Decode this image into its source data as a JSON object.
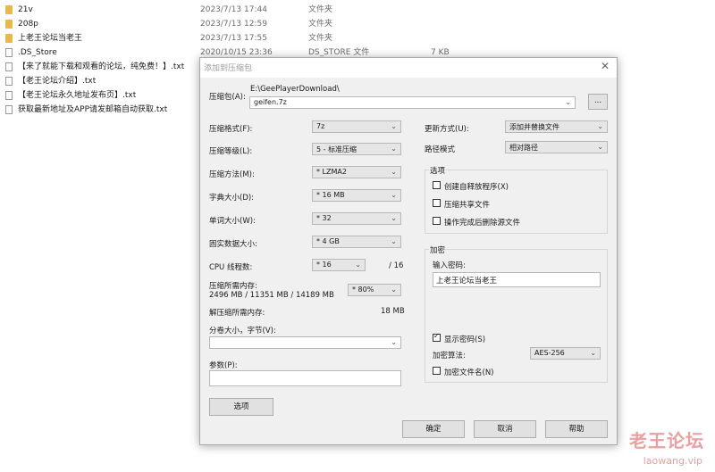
{
  "files": [
    {
      "name": "21v",
      "date": "2023/7/13 17:44",
      "type": "文件夹",
      "size": "",
      "icon": "folder-icon"
    },
    {
      "name": "208p",
      "date": "2023/7/13 12:59",
      "type": "文件夹",
      "size": "",
      "icon": "folder-icon"
    },
    {
      "name": "上老王论坛当老王",
      "date": "2023/7/13 17:55",
      "type": "文件夹",
      "size": "",
      "icon": "folder-icon"
    },
    {
      "name": ".DS_Store",
      "date": "2020/10/15 23:36",
      "type": "DS_STORE 文件",
      "size": "7 KB",
      "icon": "file-icon"
    },
    {
      "name": "【来了就能下载和观看的论坛，纯免费！】.txt",
      "date": "",
      "type": "",
      "size": "",
      "icon": "text-file-icon"
    },
    {
      "name": "【老王论坛介绍】.txt",
      "date": "",
      "type": "",
      "size": "",
      "icon": "text-file-icon"
    },
    {
      "name": "【老王论坛永久地址发布页】.txt",
      "date": "",
      "type": "",
      "size": "",
      "icon": "text-file-icon"
    },
    {
      "name": "获取最新地址及APP请发邮箱自动获取.txt",
      "date": "",
      "type": "",
      "size": "",
      "icon": "text-file-icon"
    }
  ],
  "dialog": {
    "title": "添加到压缩包",
    "archive_label": "压缩包(A):",
    "archive_path": "E:\\GeePlayerDownload\\",
    "archive_name": "geifen.7z",
    "browse_label": "...",
    "format_label": "压缩格式(F):",
    "format_value": "7z",
    "level_label": "压缩等级(L):",
    "level_value": "5 - 标准压缩",
    "method_label": "压缩方法(M):",
    "method_value": "* LZMA2",
    "dict_label": "字典大小(D):",
    "dict_value": "* 16 MB",
    "word_label": "单词大小(W):",
    "word_value": "* 32",
    "solid_label": "固实数据大小:",
    "solid_value": "* 4 GB",
    "threads_label": "CPU 线程数:",
    "threads_value": "* 16",
    "threads_total": "/ 16",
    "mem_compress_label": "压缩所需内存:",
    "mem_compress_values": "2496 MB / 11351 MB / 14189 MB",
    "mem_percent": "* 80%",
    "mem_decompress_label": "解压缩所需内存:",
    "mem_decompress_value": "18 MB",
    "split_label": "分卷大小，字节(V):",
    "split_value": "",
    "params_label": "参数(P):",
    "params_value": "",
    "options_button": "选项",
    "update_label": "更新方式(U):",
    "update_value": "添加并替换文件",
    "path_label": "路径模式",
    "path_value": "相对路径",
    "options_group": "选项",
    "opt_sfx": "创建自释放程序(X)",
    "opt_shared": "压缩共享文件",
    "opt_delete": "操作完成后删除源文件",
    "encrypt_group": "加密",
    "password_label": "输入密码:",
    "password_value": "上老王论坛当老王",
    "show_password": "显示密码(S)",
    "enc_method_label": "加密算法:",
    "enc_method_value": "AES-256",
    "encrypt_names": "加密文件名(N)",
    "ok": "确定",
    "cancel": "取消",
    "help": "帮助"
  },
  "watermark": {
    "line1": "老王论坛",
    "line2": "laowang.vip"
  }
}
